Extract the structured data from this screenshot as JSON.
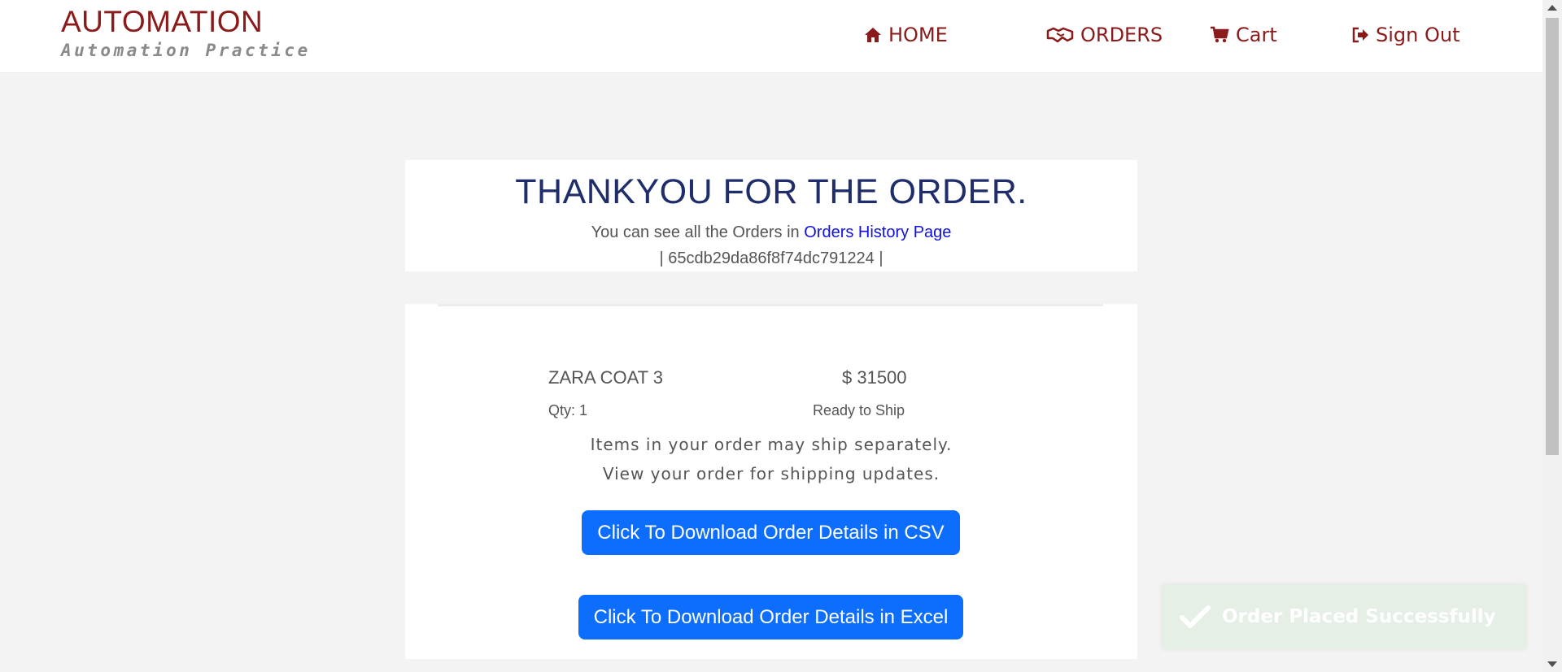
{
  "brand": {
    "title": "AUTOMATION",
    "subtitle": "Automation Practice"
  },
  "nav": {
    "home": {
      "label": "HOME",
      "icon": "home-icon"
    },
    "orders": {
      "label": "ORDERS",
      "icon": "handshake-icon"
    },
    "cart": {
      "label": "Cart",
      "icon": "cart-icon"
    },
    "signout": {
      "label": "Sign Out",
      "icon": "sign-out-icon"
    }
  },
  "confirmation": {
    "title": "THANKYOU FOR THE ORDER.",
    "history_prefix": "You can see all the Orders in ",
    "history_link": "Orders History Page",
    "order_id_line": "| 65cdb29da86f8f74dc791224 |"
  },
  "order_item": {
    "name": "ZARA COAT 3",
    "price": "$ 31500",
    "qty": "Qty: 1",
    "status": "Ready to Ship"
  },
  "notes": {
    "line1": "Items in your order may ship separately.",
    "line2": "View your order for shipping updates."
  },
  "buttons": {
    "csv": "Click To Download Order Details in CSV",
    "excel": "Click To Download Order Details in Excel"
  },
  "toast": {
    "message": "Order Placed Successfully",
    "icon": "check-icon"
  },
  "colors": {
    "brand": "#8b1a1a",
    "title": "#1f2d6b",
    "link": "#1010e0",
    "button": "#0d6efd",
    "toast_bg": "#e5efe5"
  }
}
